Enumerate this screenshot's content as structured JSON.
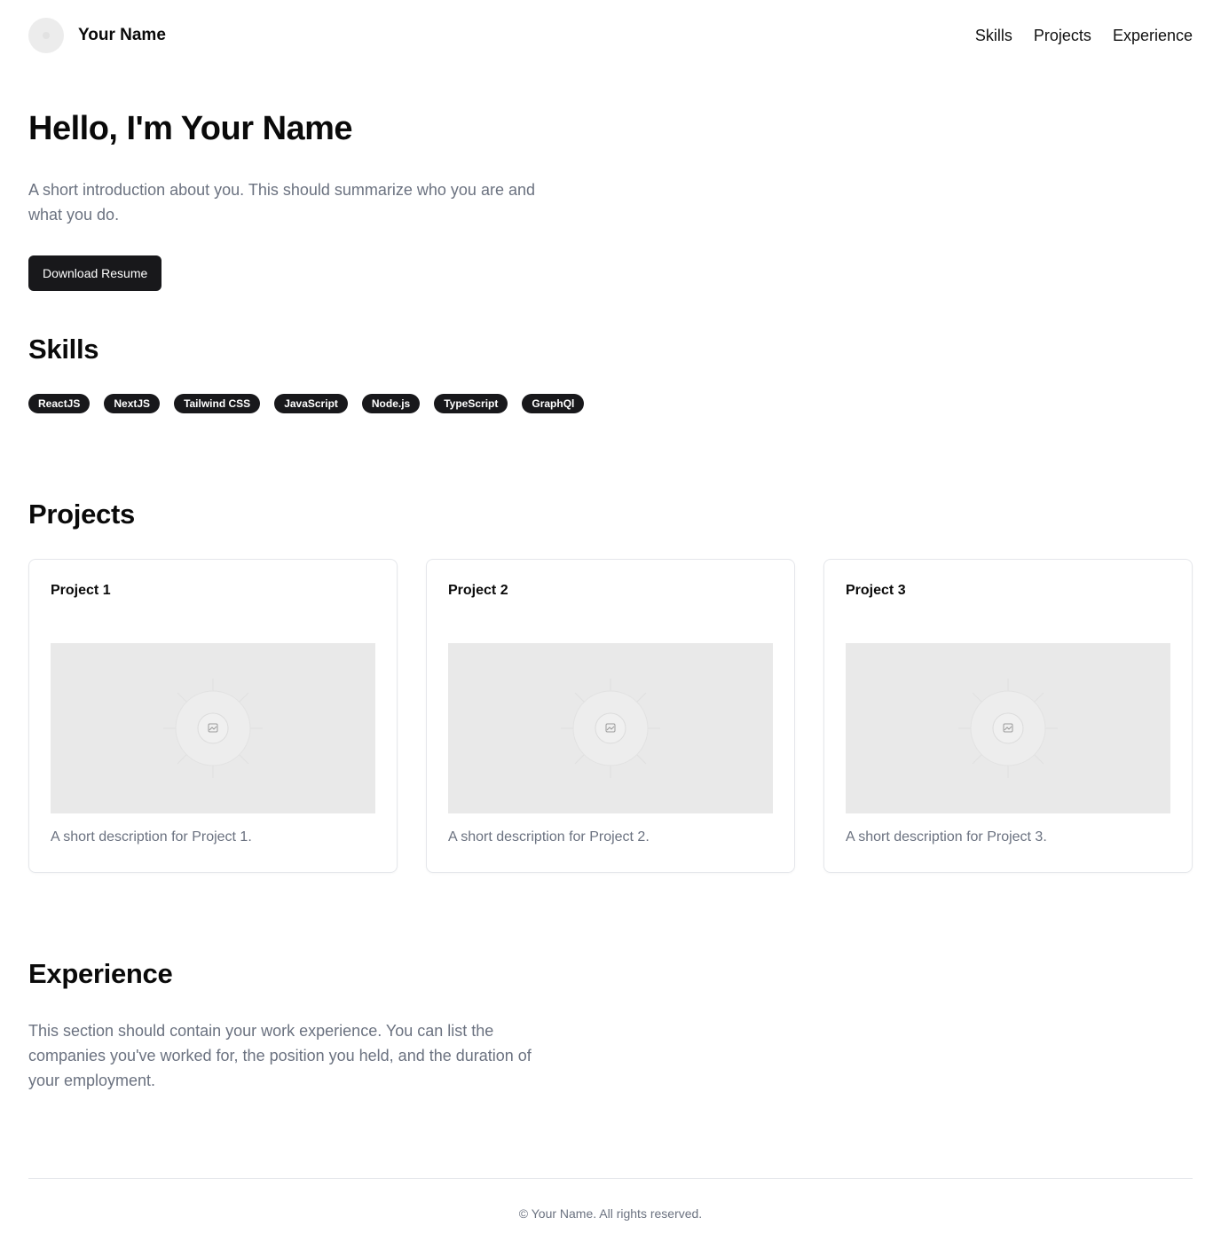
{
  "header": {
    "brand_name": "Your Name",
    "nav": [
      {
        "label": "Skills"
      },
      {
        "label": "Projects"
      },
      {
        "label": "Experience"
      }
    ]
  },
  "hero": {
    "title": "Hello, I'm Your Name",
    "intro": "A short introduction about you. This should summarize who you are and what you do.",
    "resume_button": "Download Resume"
  },
  "skills": {
    "title": "Skills",
    "items": [
      "ReactJS",
      "NextJS",
      "Tailwind CSS",
      "JavaScript",
      "Node.js",
      "TypeScript",
      "GraphQl"
    ]
  },
  "projects": {
    "title": "Projects",
    "items": [
      {
        "title": "Project 1",
        "description": "A short description for Project 1.",
        "image_icon": "image-placeholder-icon"
      },
      {
        "title": "Project 2",
        "description": "A short description for Project 2.",
        "image_icon": "image-placeholder-icon"
      },
      {
        "title": "Project 3",
        "description": "A short description for Project 3.",
        "image_icon": "image-placeholder-icon"
      }
    ]
  },
  "experience": {
    "title": "Experience",
    "text": "This section should contain your work experience. You can list the companies you've worked for, the position you held, and the duration of your employment."
  },
  "footer": {
    "text": "© Your Name. All rights reserved."
  },
  "colors": {
    "primary_button": "#18181b",
    "muted_text": "#6b7280",
    "placeholder_bg": "#e9e9e9",
    "border": "#e5e7eb"
  }
}
